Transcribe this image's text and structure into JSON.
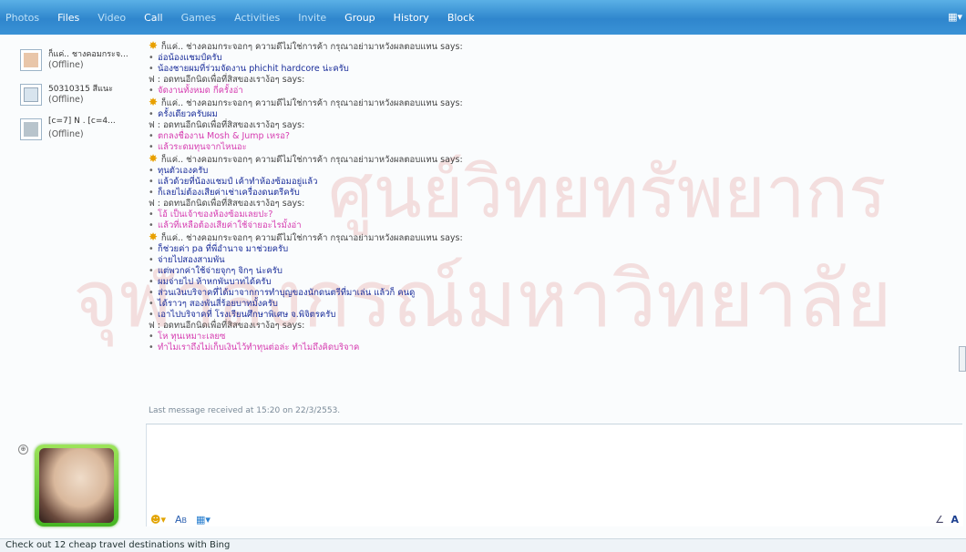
{
  "nav": {
    "tabs": [
      {
        "label": "Photos",
        "active": false
      },
      {
        "label": "Files",
        "active": true
      },
      {
        "label": "Video",
        "active": false
      },
      {
        "label": "Call",
        "active": true
      },
      {
        "label": "Games",
        "active": false
      },
      {
        "label": "Activities",
        "active": false
      },
      {
        "label": "Invite",
        "active": false
      },
      {
        "label": "Group",
        "active": true
      },
      {
        "label": "History",
        "active": true
      },
      {
        "label": "Block",
        "active": true
      }
    ],
    "menu_icon": "menu-icon"
  },
  "contacts": [
    {
      "name": "ก็แค่.. ชางคอมกระจ...",
      "status": "(Offline)"
    },
    {
      "name": "50310315 สีแนะ",
      "status": "(Offline)"
    },
    {
      "name": "[c=7] N . [c=4...",
      "status": "(Offline)"
    }
  ],
  "conversation": [
    {
      "type": "says",
      "text": "ก็แค่.. ช่างคอมกระจอกๆ ความดีไม่ใช่การค้า กรุณาอย่ามาหวังผลตอบแทน says:"
    },
    {
      "type": "a",
      "text": "อ่อน้องแชมป์ครับ"
    },
    {
      "type": "a",
      "text": "น้องชายผมที่ร่วมจัดงาน phichit hardcore น่ะครับ"
    },
    {
      "type": "says2",
      "text": "ฟ : อดทนอีกนิดเพื่อที่สิสของเราง้อๆ says:"
    },
    {
      "type": "b",
      "text": "จัดงานทั้งหมด กี่ครั้งอ่า"
    },
    {
      "type": "says",
      "text": "ก็แค่.. ช่างคอมกระจอกๆ ความดีไม่ใช่การค้า กรุณาอย่ามาหวังผลตอบแทน says:"
    },
    {
      "type": "a",
      "text": "ครั้งเดียวครับผม"
    },
    {
      "type": "says2",
      "text": "ฟ : อดทนอีกนิดเพื่อที่สิสของเราง้อๆ says:"
    },
    {
      "type": "b",
      "text": "ตกลงชื่องาน Mosh & Jump เหรอ?"
    },
    {
      "type": "b",
      "text": "แล้วระดมทุนจากไหนอะ"
    },
    {
      "type": "says",
      "text": "ก็แค่.. ช่างคอมกระจอกๆ ความดีไม่ใช่การค้า กรุณาอย่ามาหวังผลตอบแทน says:"
    },
    {
      "type": "a",
      "text": "ทุนตัวเองครับ"
    },
    {
      "type": "a",
      "text": "แล้วด้วยที่น้องแชมป์ เค้าทำห้องซ้อมอยู่แล้ว"
    },
    {
      "type": "a",
      "text": "ก็เลยไม่ต้องเสียค่าเช่าเครื่องดนตรีครับ"
    },
    {
      "type": "says2",
      "text": "ฟ : อดทนอีกนิดเพื่อที่สิสของเราง้อๆ says:"
    },
    {
      "type": "b",
      "text": "โอ้ เป็นเจ้าของห้องซ้อมเลยปะ?"
    },
    {
      "type": "b",
      "text": "แล้วที่เหลือต้องเสียค่าใช้จ่ายอะไรมั้งอ่า"
    },
    {
      "type": "says",
      "text": "ก็แค่.. ช่างคอมกระจอกๆ ความดีไม่ใช่การค้า กรุณาอย่ามาหวังผลตอบแทน says:"
    },
    {
      "type": "a",
      "text": "ก็ช่วยค่า pa ที่พี่อำนาจ มาช่วยครับ"
    },
    {
      "type": "a",
      "text": "จ่ายไปสองสามพัน"
    },
    {
      "type": "a",
      "text": "แต่พวกค่าใช้จ่ายจุกๆ จิกๆ น่ะครับ"
    },
    {
      "type": "a",
      "text": "ผมจ่ายไป ห้าหกพันบาทได้ครับ"
    },
    {
      "type": "a",
      "text": "ส่วนเงินบริจาคที่ได้มาจากการทำบุญของนักดนตรีที่มาเล่น แล้วก็ คนดู"
    },
    {
      "type": "a",
      "text": "ได้ราวๆ สองพันสี่ร้อยบาทมั้งครับ"
    },
    {
      "type": "a",
      "text": "เอาไปบริจาคที่ โรงเรียนศึกษาพิเศษ จ.พิจิตรครับ"
    },
    {
      "type": "says2",
      "text": "ฟ : อดทนอีกนิดเพื่อที่สิสของเราง้อๆ says:"
    },
    {
      "type": "b",
      "text": "โห ทุนเหมาะเลยซ"
    },
    {
      "type": "b",
      "text": "ทำไมเราถึงไม่เก็บเงินไว้ทำทุนต่อล่ะ ทำไมถึงคิดบริจาค"
    }
  ],
  "last_message": "Last message received at 15:20 on 22/3/2553.",
  "input": {
    "placeholder": ""
  },
  "toolbar": {
    "font_icon": "font-icon"
  },
  "corner_label": "A",
  "status_bar": "Check out 12 cheap travel destinations with Bing",
  "watermark": {
    "line1": "ศูนย์วิทยทรัพยากร",
    "line2": "จุฬาลงกรณ์มหาวิทยาลัย"
  }
}
